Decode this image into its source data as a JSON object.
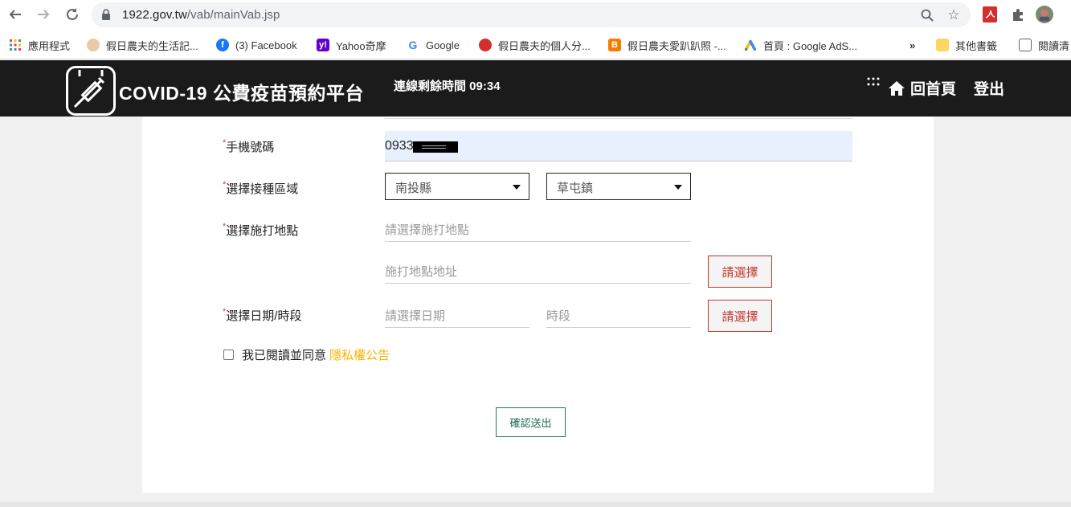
{
  "browser": {
    "url_host": "1922.gov.tw",
    "url_path": "/vab/mainVab.jsp",
    "bookmarks": [
      {
        "label": "應用程式",
        "icon": "apps-grid-icon",
        "color": "#4285f4"
      },
      {
        "label": "假日農夫的生活記...",
        "icon": "avatar-icon",
        "color": "#c98a5a"
      },
      {
        "label": "(3) Facebook",
        "icon": "facebook-icon",
        "color": "#1877f2"
      },
      {
        "label": "Yahoo奇摩",
        "icon": "yahoo-icon",
        "color": "#6001d2"
      },
      {
        "label": "Google",
        "icon": "google-icon",
        "color": "#4285f4"
      },
      {
        "label": "假日農夫的個人分...",
        "icon": "pin-icon",
        "color": "#e53935"
      },
      {
        "label": "假日農夫愛趴趴照 -...",
        "icon": "blogger-icon",
        "color": "#f57c00"
      },
      {
        "label": "首頁 : Google AdS...",
        "icon": "google-ads-icon",
        "color": "#fbbc04"
      }
    ],
    "more_label": "»",
    "other_bookmarks": "其他書籤",
    "reading_list": "閱讀清"
  },
  "header": {
    "title": "COVID-19 公費疫苗預約平台",
    "timer_label": "連線剩餘時間 09:34",
    "home_label": "回首頁",
    "logout_label": "登出",
    "bg_color": "#1b1b1b"
  },
  "form": {
    "required_mark": "*",
    "phone": {
      "label": "手機號碼",
      "value": "0933"
    },
    "region": {
      "label": "選擇接種區域",
      "county": "南投縣",
      "township": "草屯鎮"
    },
    "site": {
      "label": "選擇施打地點",
      "placeholder": "請選擇施打地點",
      "address_placeholder": "施打地點地址",
      "button": "請選擇"
    },
    "datetime": {
      "label": "選擇日期/時段",
      "date_placeholder": "請選擇日期",
      "slot_placeholder": "時段",
      "button": "請選擇"
    },
    "consent": {
      "text": "我已閱讀並同意",
      "link": "隱私權公告",
      "checked": false
    },
    "submit": "確認送出"
  },
  "colors": {
    "accent_red": "#c0392b",
    "link_yellow": "#f5b400",
    "submit_green": "#1a7a5e",
    "autofill_bg": "#e8f0fe"
  }
}
